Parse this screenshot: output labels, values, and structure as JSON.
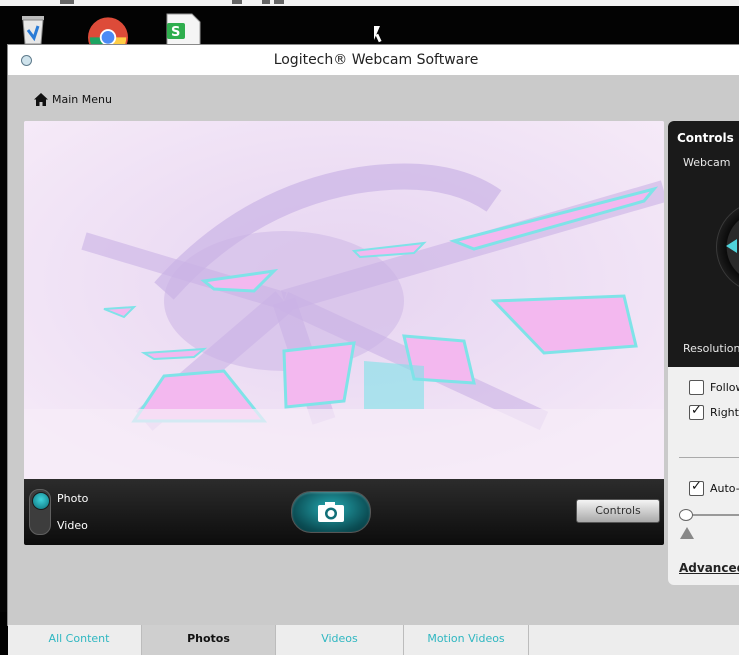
{
  "window": {
    "title": "Logitech® Webcam Software"
  },
  "nav": {
    "main_menu": "Main Menu"
  },
  "toolbar": {
    "photo_label": "Photo",
    "video_label": "Video",
    "mode": "photo",
    "controls_button": "Controls"
  },
  "controls_panel": {
    "heading": "Controls",
    "webcam_label": "Webcam",
    "resolution_label": "Resolution",
    "follow_label": "Follow",
    "follow_checked": false,
    "rightlight_label": "RightL",
    "rightlight_checked": true,
    "auto_label": "Auto-f",
    "auto_checked": true,
    "advanced_link": "Advanced"
  },
  "tabs": [
    {
      "label": "All Content",
      "active": false
    },
    {
      "label": "Photos",
      "active": true
    },
    {
      "label": "Videos",
      "active": false
    },
    {
      "label": "Motion Videos",
      "active": false
    }
  ],
  "colors": {
    "accent": "#2fb7c1",
    "preview_bg": "#f3e8f6",
    "preview_purple": "#d7c3ea",
    "preview_cyan": "#7fe3e8",
    "preview_pink": "#f3b8ef"
  }
}
